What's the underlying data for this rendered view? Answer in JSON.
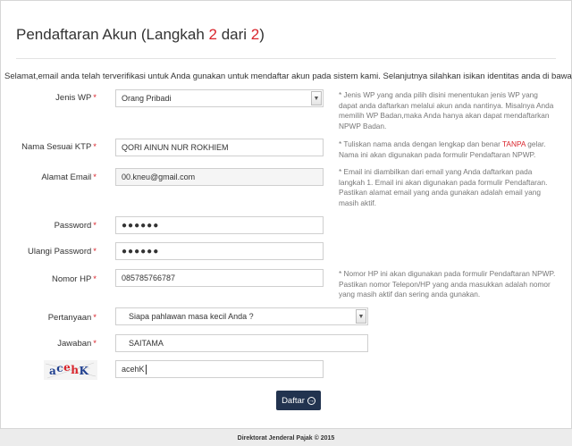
{
  "title": {
    "prefix": "Pendaftaran Akun  (Langkah ",
    "step": "2",
    "mid": " dari ",
    "total": "2",
    "suffix": ")"
  },
  "intro": "Selamat,email anda telah terverifikasi untuk Anda gunakan untuk mendaftar akun pada sistem kami. Selanjutnya silahkan isikan identitas anda di bawah ini.",
  "required_mark": "*",
  "fields": {
    "jenis_wp": {
      "label": "Jenis WP",
      "value": "Orang Pribadi"
    },
    "nama": {
      "label": "Nama Sesuai KTP",
      "value": "QORI AINUN NUR ROKHIEM"
    },
    "email": {
      "label": "Alamat Email",
      "value": "00.kneu@gmail.com"
    },
    "password": {
      "label": "Password",
      "value": "●●●●●●"
    },
    "ulangi_password": {
      "label": "Ulangi Password",
      "value": "●●●●●●"
    },
    "nomor_hp": {
      "label": "Nomor HP",
      "value": "085785766787"
    },
    "pertanyaan": {
      "label": "Pertanyaan",
      "value": "Siapa pahlawan masa kecil Anda ?"
    },
    "jawaban": {
      "label": "Jawaban",
      "value": "SAITAMA"
    },
    "captcha_input": {
      "value": "acehK"
    }
  },
  "captcha": {
    "text": "acehK",
    "chars": [
      "a",
      "c",
      "e",
      "h",
      "K"
    ]
  },
  "hints": {
    "jenis_wp": [
      "* Jenis WP yang anda pilih disini menentukan jenis WP yang",
      "dapat anda daftarkan melalui akun anda nantinya. Misalnya Anda",
      "memilih WP Badan,maka Anda hanya akan dapat mendaftarkan",
      "NPWP Badan."
    ],
    "nama": {
      "line1_before": "* Tuliskan nama anda dengan lengkap dan benar ",
      "line1_red": "TANPA",
      "line1_after": " gelar.",
      "line2": "Nama ini akan digunakan pada formulir Pendaftaran NPWP."
    },
    "email": [
      "* Email ini diambilkan dari email yang Anda daftarkan pada",
      "langkah 1. Email ini akan digunakan pada formulir Pendaftaran.",
      "Pastikan alamat email yang anda gunakan adalah email yang",
      "masih aktif."
    ],
    "nomor_hp": [
      "* Nomor HP ini akan digunakan pada formulir Pendaftaran NPWP.",
      "Pastikan nomor Telepon/HP yang anda masukkan adalah nomor",
      "yang masih aktif dan sering anda gunakan."
    ]
  },
  "submit": {
    "label": "Daftar",
    "icon": "arrow-right-circle-icon",
    "icon_glyph": "→"
  },
  "footer": "Direktorat Jenderal Pajak © 2015",
  "colors": {
    "accent_red": "#d9242b",
    "button_bg": "#22334f",
    "captcha_colors": [
      "#1f3f8f",
      "#1f3f8f",
      "#d9242b",
      "#d9242b",
      "#1f3f8f"
    ]
  }
}
